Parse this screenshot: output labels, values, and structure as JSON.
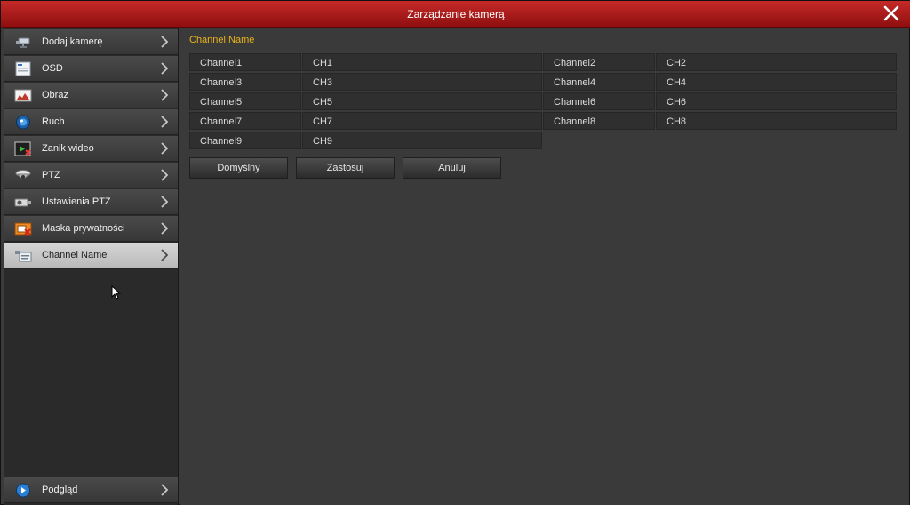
{
  "window": {
    "title": "Zarządzanie kamerą"
  },
  "sidebar": {
    "items": [
      {
        "label": "Dodaj kamerę",
        "icon": "add-camera-icon"
      },
      {
        "label": "OSD",
        "icon": "osd-icon"
      },
      {
        "label": "Obraz",
        "icon": "image-icon"
      },
      {
        "label": "Ruch",
        "icon": "motion-icon"
      },
      {
        "label": "Zanik wideo",
        "icon": "video-loss-icon"
      },
      {
        "label": "PTZ",
        "icon": "ptz-icon"
      },
      {
        "label": "Ustawienia PTZ",
        "icon": "ptz-settings-icon"
      },
      {
        "label": "Maska prywatności",
        "icon": "privacy-mask-icon"
      },
      {
        "label": "Channel Name",
        "icon": "channel-name-icon",
        "active": true
      }
    ],
    "bottom": {
      "label": "Podgląd",
      "icon": "preview-icon"
    }
  },
  "main": {
    "section_title": "Channel Name",
    "channels": [
      {
        "label": "Channel1",
        "value": "CH1"
      },
      {
        "label": "Channel2",
        "value": "CH2"
      },
      {
        "label": "Channel3",
        "value": "CH3"
      },
      {
        "label": "Channel4",
        "value": "CH4"
      },
      {
        "label": "Channel5",
        "value": "CH5"
      },
      {
        "label": "Channel6",
        "value": "CH6"
      },
      {
        "label": "Channel7",
        "value": "CH7"
      },
      {
        "label": "Channel8",
        "value": "CH8"
      },
      {
        "label": "Channel9",
        "value": "CH9"
      }
    ],
    "buttons": {
      "default": "Domyślny",
      "apply": "Zastosuj",
      "cancel": "Anuluj"
    }
  },
  "colors": {
    "title_bar": "#b01c1a",
    "section_title": "#e8b21d",
    "active_item": "#cfcfcf"
  }
}
